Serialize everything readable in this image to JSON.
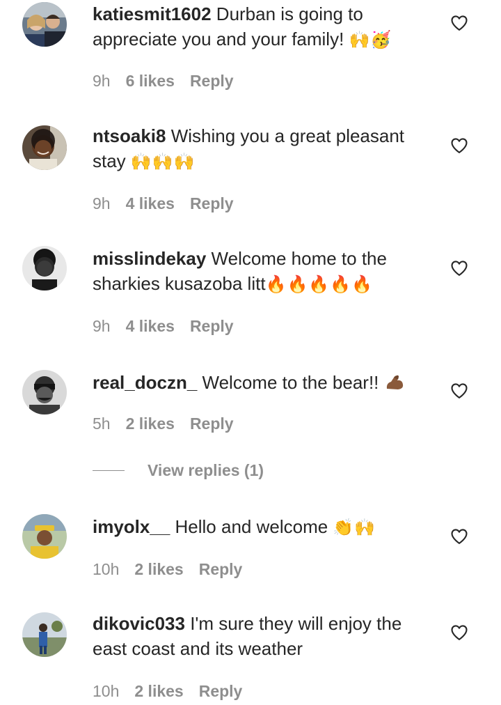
{
  "comments": [
    {
      "username": "katiesmit1602",
      "text": " Durban is going to appreciate you and your family! ",
      "emoji": "🙌🥳",
      "time": "9h",
      "likes": "6 likes",
      "reply": "Reply"
    },
    {
      "username": "ntsoaki8",
      "text": " Wishing you a great pleasant stay ",
      "emoji": "🙌🙌🙌",
      "time": "9h",
      "likes": "4 likes",
      "reply": "Reply"
    },
    {
      "username": "misslindekay",
      "text": " Welcome home to the sharkies kusazoba litt",
      "emoji": "🔥🔥🔥🔥🔥",
      "time": "9h",
      "likes": "4 likes",
      "reply": "Reply"
    },
    {
      "username": "real_doczn_",
      "text": " Welcome to the bear!! ",
      "emoji": "💪",
      "time": "5h",
      "likes": "2 likes",
      "reply": "Reply",
      "view_replies": "View replies (1)"
    },
    {
      "username": "imyolx__",
      "text": " Hello and welcome ",
      "emoji": "👏🙌",
      "time": "10h",
      "likes": "2 likes",
      "reply": "Reply"
    },
    {
      "username": "dikovic033",
      "text": " I'm sure they will enjoy the east coast and its weather",
      "emoji": "",
      "time": "10h",
      "likes": "2 likes",
      "reply": "Reply"
    }
  ],
  "icons": {
    "like": "heart-outline-icon",
    "avatar": "avatar"
  },
  "colors": {
    "text": "#262626",
    "secondary": "#8e8e8e",
    "background": "#ffffff"
  }
}
